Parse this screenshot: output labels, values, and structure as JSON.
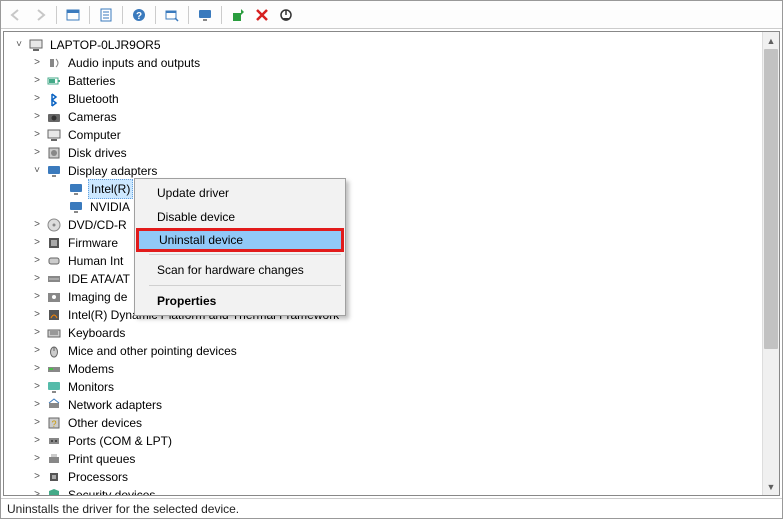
{
  "toolbar": {
    "back": "Back",
    "forward": "Forward",
    "show_hidden": "Show hidden devices",
    "properties": "Properties",
    "help": "Help",
    "scan": "Scan for hardware changes",
    "update": "Update driver",
    "monitor": "Remote",
    "uninstall": "Uninstall",
    "disable": "Disable"
  },
  "tree": {
    "root": "LAPTOP-0LJR9OR5",
    "categories": [
      {
        "label": "Audio inputs and outputs",
        "icon": "audio"
      },
      {
        "label": "Batteries",
        "icon": "battery"
      },
      {
        "label": "Bluetooth",
        "icon": "bluetooth"
      },
      {
        "label": "Cameras",
        "icon": "camera"
      },
      {
        "label": "Computer",
        "icon": "computer"
      },
      {
        "label": "Disk drives",
        "icon": "disk"
      },
      {
        "label": "Display adapters",
        "icon": "display",
        "expanded": true,
        "children": [
          {
            "label": "Intel(R)",
            "icon": "display",
            "selected": true
          },
          {
            "label": "NVIDIA",
            "icon": "display"
          }
        ]
      },
      {
        "label": "DVD/CD-R",
        "icon": "dvd"
      },
      {
        "label": "Firmware",
        "icon": "firmware"
      },
      {
        "label": "Human Int",
        "icon": "hid"
      },
      {
        "label": "IDE ATA/AT",
        "icon": "ide"
      },
      {
        "label": "Imaging de",
        "icon": "imaging"
      },
      {
        "label": "Intel(R) Dynamic Platform and Thermal Framework",
        "icon": "thermal"
      },
      {
        "label": "Keyboards",
        "icon": "keyboard"
      },
      {
        "label": "Mice and other pointing devices",
        "icon": "mouse"
      },
      {
        "label": "Modems",
        "icon": "modem"
      },
      {
        "label": "Monitors",
        "icon": "monitor"
      },
      {
        "label": "Network adapters",
        "icon": "network"
      },
      {
        "label": "Other devices",
        "icon": "other"
      },
      {
        "label": "Ports (COM & LPT)",
        "icon": "ports"
      },
      {
        "label": "Print queues",
        "icon": "printer"
      },
      {
        "label": "Processors",
        "icon": "cpu"
      },
      {
        "label": "Security devices",
        "icon": "security"
      }
    ]
  },
  "context_menu": {
    "update": "Update driver",
    "disable": "Disable device",
    "uninstall": "Uninstall device",
    "scan": "Scan for hardware changes",
    "properties": "Properties"
  },
  "statusbar": {
    "text": "Uninstalls the driver for the selected device."
  }
}
